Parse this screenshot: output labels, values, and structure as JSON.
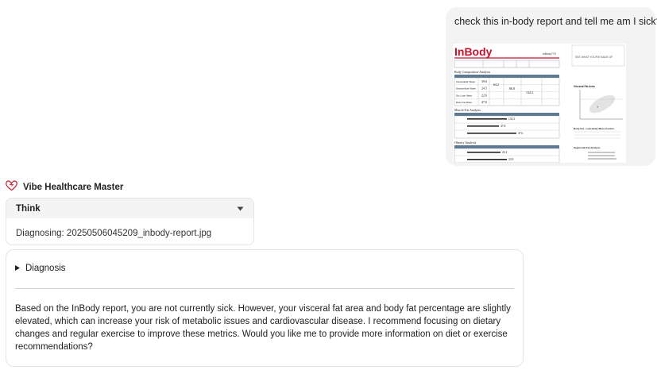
{
  "user_message": {
    "text": "check this in-body report and tell me am I sick?"
  },
  "report": {
    "brand": "InBody",
    "model": "InBody770",
    "tagline": "SEE WHAT YOU'RE MADE OF",
    "sections": [
      "Body Composition Analysis",
      "Muscle-Fat Analysis",
      "Obesity Analysis"
    ],
    "body_composition": [
      {
        "label": "Intracellular Water",
        "value": "39.6"
      },
      {
        "label": "Extracellular Water",
        "value": "24.5"
      },
      {
        "label": "Dry Lean Mass",
        "value": "22.6"
      },
      {
        "label": "Body Fat Mass",
        "value": "47.6"
      }
    ],
    "totals": [
      "64.2",
      "86.8",
      "134.3"
    ],
    "muscle_fat_values": [
      "134.3",
      "47.8",
      "47.6"
    ],
    "obesity_values": [
      "22.2",
      "33.9"
    ],
    "side_titles": [
      "Visceral Fat Area",
      "Body Fat - Lean Body Mass Control",
      "Segmental Fat Analysis"
    ]
  },
  "assistant": {
    "name": "Vibe Healthcare Master",
    "think": {
      "label": "Think",
      "content": "Diagnosing: 20250506045209_inbody-report.jpg"
    },
    "diagnosis_label": "Diagnosis",
    "answer": "Based on the InBody report, you are not currently sick. However, your visceral fat area and body fat percentage are slightly elevated, which can increase your risk of metabolic issues and cardiovascular disease. I recommend focusing on dietary changes and regular exercise to improve these metrics. Would you like me to provide more information on diet or exercise recommendations?"
  },
  "colors": {
    "brand_red": "#c8102e",
    "bubble_bg": "#f3f3f3",
    "think_header_bg": "#f4f4f4"
  }
}
